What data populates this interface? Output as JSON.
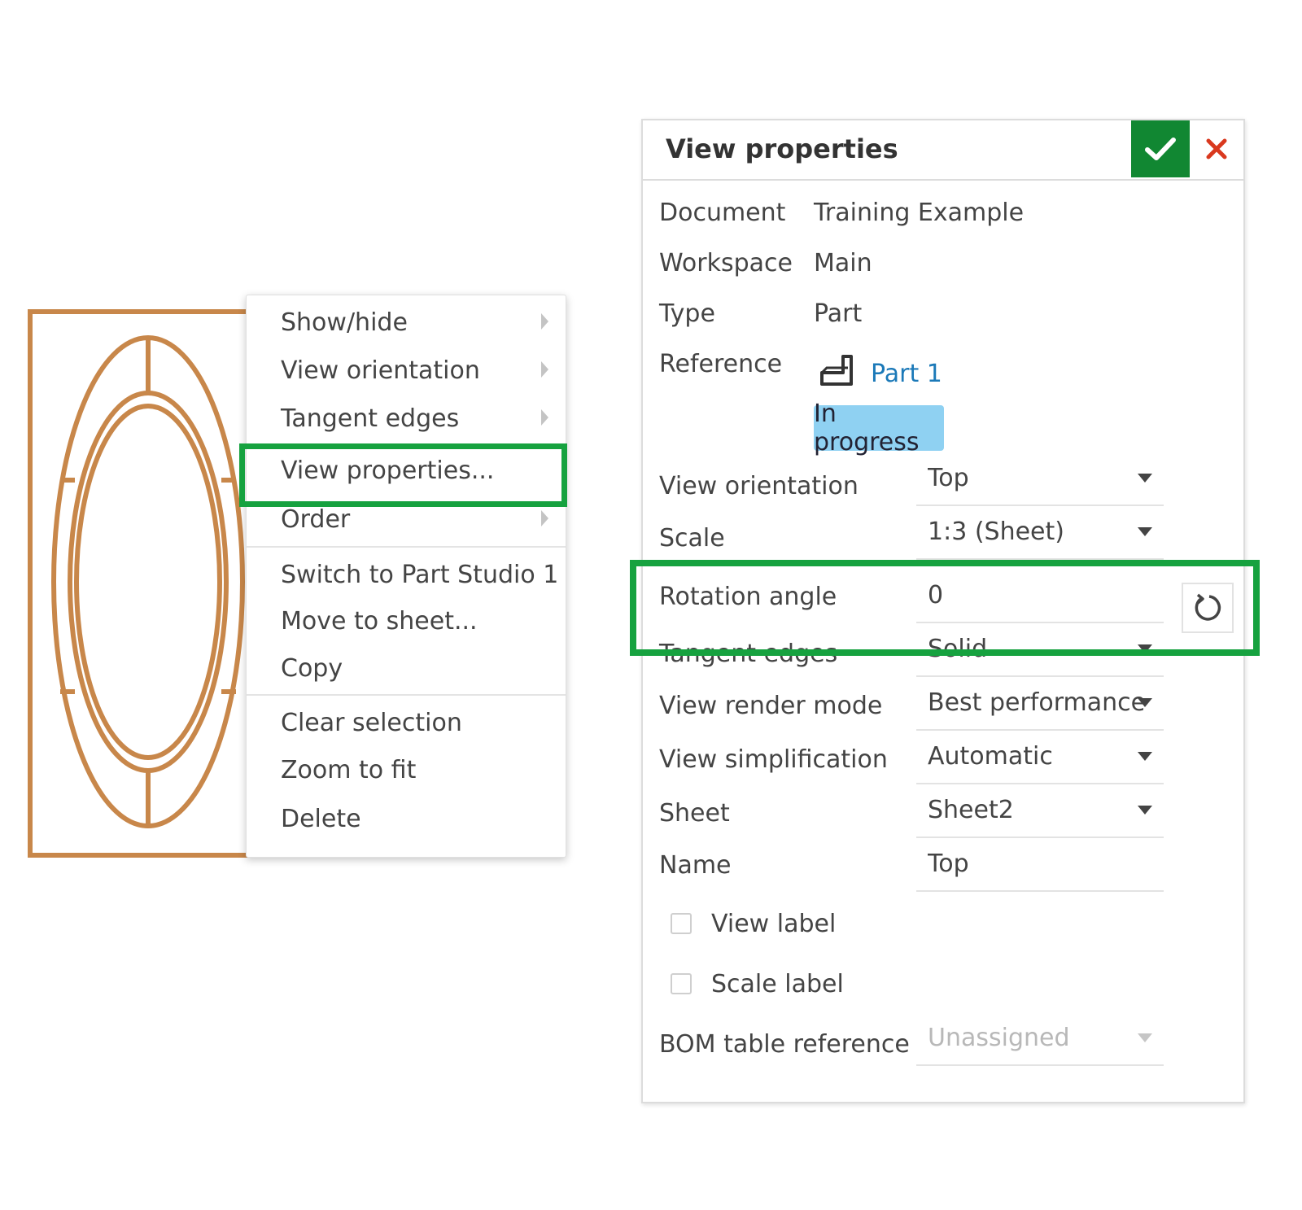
{
  "context_menu": {
    "items": [
      {
        "label": "Show/hide",
        "submenu": true
      },
      {
        "label": "View orientation",
        "submenu": true
      },
      {
        "label": "Tangent edges",
        "submenu": true
      },
      {
        "label": "View properties...",
        "submenu": false,
        "highlighted": true
      },
      {
        "label": "Order",
        "submenu": true
      },
      {
        "label": "Switch to Part Studio 1",
        "submenu": false
      },
      {
        "label": "Move to sheet...",
        "submenu": false
      },
      {
        "label": "Copy",
        "submenu": false
      },
      {
        "label": "Clear selection",
        "submenu": false
      },
      {
        "label": "Zoom to fit",
        "submenu": false
      },
      {
        "label": "Delete",
        "submenu": false
      }
    ]
  },
  "dialog": {
    "title": "View properties",
    "document": {
      "label": "Document",
      "value": "Training Example"
    },
    "workspace": {
      "label": "Workspace",
      "value": "Main"
    },
    "type": {
      "label": "Type",
      "value": "Part"
    },
    "reference": {
      "label": "Reference",
      "value": "Part 1",
      "status": "In progress"
    },
    "view_orientation": {
      "label": "View orientation",
      "value": "Top"
    },
    "scale": {
      "label": "Scale",
      "value": "1:3 (Sheet)"
    },
    "rotation_angle": {
      "label": "Rotation angle",
      "value": "0"
    },
    "tangent_edges": {
      "label": "Tangent edges",
      "value": "Solid"
    },
    "view_render_mode": {
      "label": "View render mode",
      "value": "Best performance"
    },
    "view_simplification": {
      "label": "View simplification",
      "value": "Automatic"
    },
    "sheet": {
      "label": "Sheet",
      "value": "Sheet2"
    },
    "name": {
      "label": "Name",
      "value": "Top"
    },
    "view_label": {
      "label": "View label",
      "checked": false
    },
    "scale_label": {
      "label": "Scale label",
      "checked": false
    },
    "bom_table_reference": {
      "label": "BOM table reference",
      "value": "Unassigned"
    }
  },
  "colors": {
    "accent_green": "#118732",
    "highlight_green": "#16a23f",
    "cancel_red": "#d9381e",
    "drawing_stroke": "#c8874a",
    "status_badge": "#8fd1f2",
    "link_blue": "#1b79b8"
  },
  "icons": [
    "chevron-right-icon",
    "check-icon",
    "close-icon",
    "part-icon",
    "reset-rotation-icon",
    "dropdown-arrow-icon"
  ]
}
